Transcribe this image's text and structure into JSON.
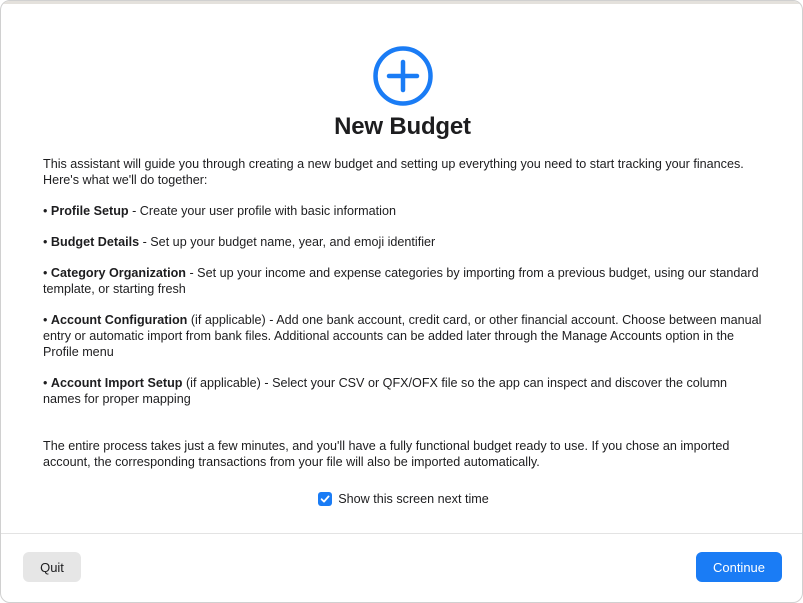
{
  "dialog": {
    "title": "New Budget",
    "icon": "plus-circle-icon",
    "accent_color": "#1a7cf5"
  },
  "content": {
    "intro": "This assistant will guide you through creating a new budget and setting up everything you need to start tracking your finances. Here's what we'll do together:",
    "bullets": [
      {
        "bullet": "•",
        "title": "Profile Setup",
        "qualifier": "",
        "text": " - Create your user profile with basic information"
      },
      {
        "bullet": "•",
        "title": "Budget Details",
        "qualifier": "",
        "text": " - Set up your budget name, year, and emoji identifier"
      },
      {
        "bullet": "•",
        "title": "Category Organization",
        "qualifier": "",
        "text": " - Set up your income and expense categories by importing from a previous budget, using our standard template, or starting fresh"
      },
      {
        "bullet": "•",
        "title": "Account Configuration",
        "qualifier": " (if applicable)",
        "text": " - Add one bank account, credit card, or other financial account. Choose between manual entry or automatic import from bank files. Additional accounts can be added later through the Manage Accounts option in the Profile menu"
      },
      {
        "bullet": "•",
        "title": "Account Import Setup",
        "qualifier": " (if applicable)",
        "text": " - Select your CSV or QFX/OFX file so the app can inspect and discover the column names for proper mapping"
      }
    ],
    "outro": "The entire process takes just a few minutes, and you'll have a fully functional budget ready to use. If you chose an imported account, the corresponding transactions from your file will also be imported automatically."
  },
  "checkbox": {
    "label": "Show this screen next time",
    "checked": true
  },
  "buttons": {
    "quit_label": "Quit",
    "continue_label": "Continue"
  }
}
